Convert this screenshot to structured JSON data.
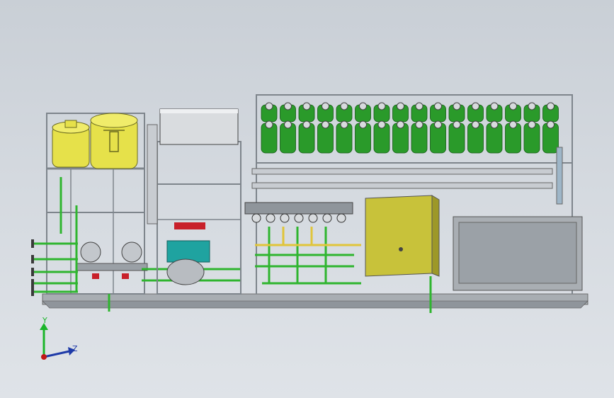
{
  "viewport": {
    "background_top": "#c9cfd6",
    "background_bottom": "#dfe3e8"
  },
  "triad": {
    "y_label": "Y",
    "z_label": "Z",
    "y_color": "#1bb52a",
    "z_color": "#1e3aa8",
    "x_color": "#c01818"
  },
  "model": {
    "frame_color": "#9aa0a6",
    "pipe_green": "#2fb52f",
    "tank_yellow": "#e6e14a",
    "cylinder_green": "#2a9a2a",
    "cabinet_olive": "#c8c23a",
    "enclosure_gray": "#a9aeb3",
    "pump_teal": "#1fa3a0",
    "motor_red": "#c8202a"
  }
}
